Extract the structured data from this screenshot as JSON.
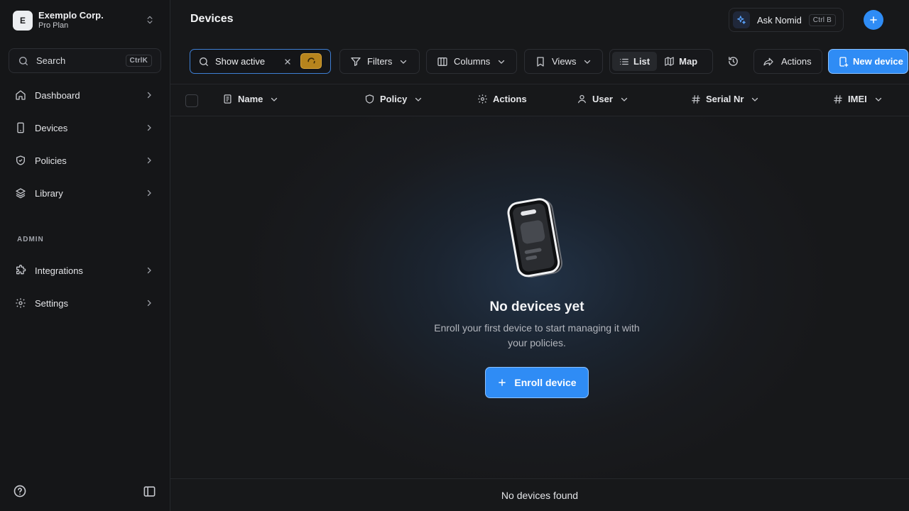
{
  "org": {
    "initial": "E",
    "name": "Exemplo Corp.",
    "plan": "Pro Plan"
  },
  "search": {
    "label": "Search",
    "shortcut": "CtrlK"
  },
  "nav": {
    "items": [
      {
        "label": "Dashboard",
        "icon": "home-icon"
      },
      {
        "label": "Devices",
        "icon": "device-icon"
      },
      {
        "label": "Policies",
        "icon": "shield-icon"
      },
      {
        "label": "Library",
        "icon": "layers-icon"
      }
    ],
    "admin_label": "ADMIN",
    "admin_items": [
      {
        "label": "Integrations",
        "icon": "puzzle-icon"
      },
      {
        "label": "Settings",
        "icon": "gear-icon"
      }
    ]
  },
  "header": {
    "title": "Devices",
    "ask_label": "Ask Nomid",
    "ask_shortcut": "Ctrl B"
  },
  "toolbar": {
    "filter_value": "Show active",
    "filters_label": "Filters",
    "columns_label": "Columns",
    "views_label": "Views",
    "view_list": "List",
    "view_map": "Map",
    "active_view": "List",
    "actions_label": "Actions",
    "new_device_label": "New device"
  },
  "table": {
    "columns": [
      "Name",
      "Policy",
      "Actions",
      "User",
      "Serial Nr",
      "IMEI"
    ]
  },
  "empty_state": {
    "title": "No devices yet",
    "subtitle": "Enroll your first device to start managing it with your policies.",
    "button": "Enroll device"
  },
  "footer": {
    "status": "No devices found"
  },
  "colors": {
    "accent": "#2f8cf5",
    "background": "#17181a",
    "sidebar": "#151618",
    "warning": "#b7841d"
  }
}
